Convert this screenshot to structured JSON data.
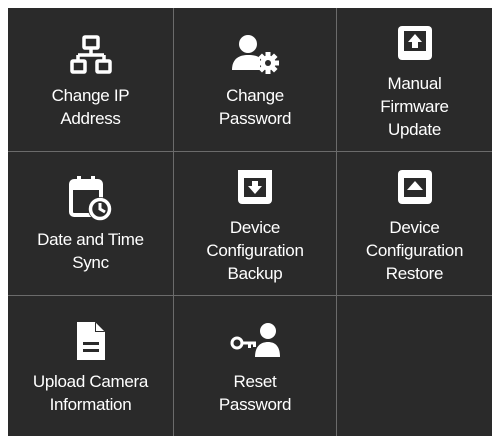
{
  "tiles": [
    {
      "label": "Change IP\nAddress",
      "icon": "network-icon"
    },
    {
      "label": "Change\nPassword",
      "icon": "user-settings-icon"
    },
    {
      "label": "Manual\nFirmware\nUpdate",
      "icon": "upload-box-icon"
    },
    {
      "label": "Date and Time\nSync",
      "icon": "calendar-clock-icon"
    },
    {
      "label": "Device\nConfiguration\nBackup",
      "icon": "archive-down-icon"
    },
    {
      "label": "Device\nConfiguration\nRestore",
      "icon": "archive-up-icon"
    },
    {
      "label": "Upload Camera\nInformation",
      "icon": "document-icon"
    },
    {
      "label": "Reset\nPassword",
      "icon": "key-user-icon"
    }
  ]
}
